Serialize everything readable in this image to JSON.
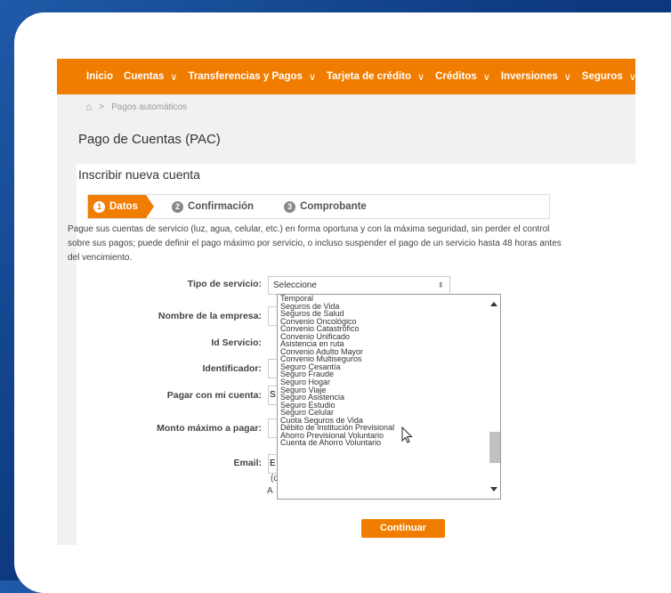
{
  "nav": {
    "items": [
      "Inicio",
      "Cuentas",
      "Transferencias y Pagos",
      "Tarjeta de crédito",
      "Créditos",
      "Inversiones",
      "Seguros"
    ]
  },
  "breadcrumb": {
    "current": "Pagos automáticos"
  },
  "page": {
    "title": "Pago de Cuentas (PAC)",
    "subtitle": "Inscribir nueva cuenta"
  },
  "steps": [
    {
      "num": "1",
      "label": "Datos"
    },
    {
      "num": "2",
      "label": "Confirmación"
    },
    {
      "num": "3",
      "label": "Comprobante"
    }
  ],
  "description": "Pague sus cuentas de servicio (luz, agua, celular, etc.) en forma oportuna y con la máxima seguridad, sin perder el control sobre sus pagos; puede definir el pago máximo por servicio, o incluso suspender el pago de un servicio hasta 48 horas antes del vencimiento.",
  "form": {
    "tipo_label": "Tipo de servicio:",
    "tipo_value": "Seleccione",
    "empresa_label": "Nombre de la empresa:",
    "id_label": "Id Servicio:",
    "identificador_label": "Identificador:",
    "cuenta_label": "Pagar con mi cuenta:",
    "cuenta_value": "S",
    "monto_label": "Monto máximo a pagar:",
    "email_label": "Email:",
    "email_value": "E",
    "email_note1": "(d",
    "email_note2": "A"
  },
  "dropdown_options": [
    "Temporal",
    "Seguros de Vida",
    "Seguros de Salud",
    "Convenio Oncológico",
    "Convenio Catastrófico",
    "Convenio Unificado",
    "Asistencia en ruta",
    "Convenio Adulto Mayor",
    "Convenio Multiseguros",
    "Seguro Cesantía",
    "Seguro Fraude",
    "Seguro Hogar",
    "Seguro Viaje",
    "Seguro Asistencia",
    "Seguro Estudio",
    "Seguro Celular",
    "Cuota Seguros de Vida",
    "Débito de Institución Previsional",
    "Ahorro Previsional Voluntario",
    "Cuenta de Ahorro Voluntario"
  ],
  "continue_label": "Continuar"
}
